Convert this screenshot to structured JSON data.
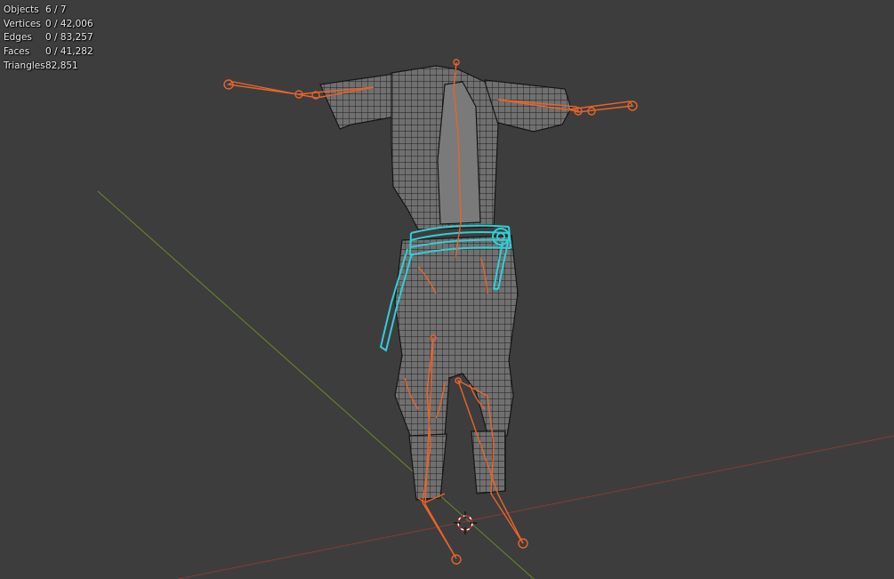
{
  "viewport": {
    "background": "#3d3d3d",
    "statistics": [
      {
        "label": "Objects",
        "value": "6 / 7"
      },
      {
        "label": "Vertices",
        "value": "0 / 42,006"
      },
      {
        "label": "Edges",
        "value": "0 / 83,257"
      },
      {
        "label": "Faces",
        "value": "0 / 41,282"
      },
      {
        "label": "Triangles",
        "value": "82,851"
      }
    ]
  },
  "colors": {
    "x_axis": "#8a3a3a",
    "y_axis": "#6a8a2a",
    "armature_bones": "#e8642a",
    "selected_belt": "#2fd0d8",
    "mesh_fill": "#6e6e6e",
    "mesh_wire": "#1c1c1c"
  }
}
